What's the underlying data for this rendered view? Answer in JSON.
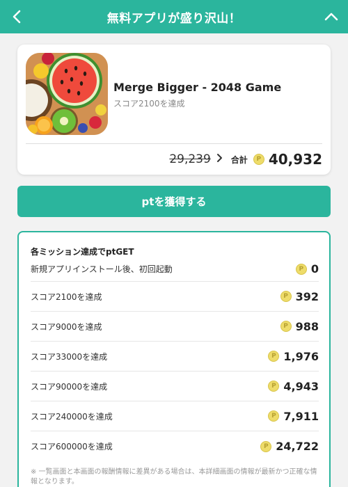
{
  "header": {
    "title": "無料アプリが盛り沢山！",
    "back_icon": "chevron-left-icon",
    "collapse_icon": "chevron-up-icon"
  },
  "app": {
    "name": "Merge Bigger - 2048 Game",
    "subtitle": "スコア2100を達成",
    "old_points": "29,239",
    "total_label": "合計",
    "total_points": "40,932",
    "coin_glyph": "P"
  },
  "get_button": {
    "label": "ptを獲得する"
  },
  "missions": {
    "heading": "各ミッション達成でptGET",
    "items": [
      {
        "label": "新規アプリインストール後、初回起動",
        "points": "0"
      },
      {
        "label": "スコア2100を達成",
        "points": "392"
      },
      {
        "label": "スコア9000を達成",
        "points": "988"
      },
      {
        "label": "スコア33000を達成",
        "points": "1,976"
      },
      {
        "label": "スコア90000を達成",
        "points": "4,943"
      },
      {
        "label": "スコア240000を達成",
        "points": "7,911"
      },
      {
        "label": "スコア600000を達成",
        "points": "24,722"
      }
    ],
    "footnote": "※ 一覧画面と本画面の報酬情報に差異がある場合は、本詳細画面の情報が最新かつ正確な情報となります。"
  },
  "colors": {
    "accent": "#2bb59d",
    "background": "#f2f2f2",
    "coin": "#eedc6a"
  }
}
